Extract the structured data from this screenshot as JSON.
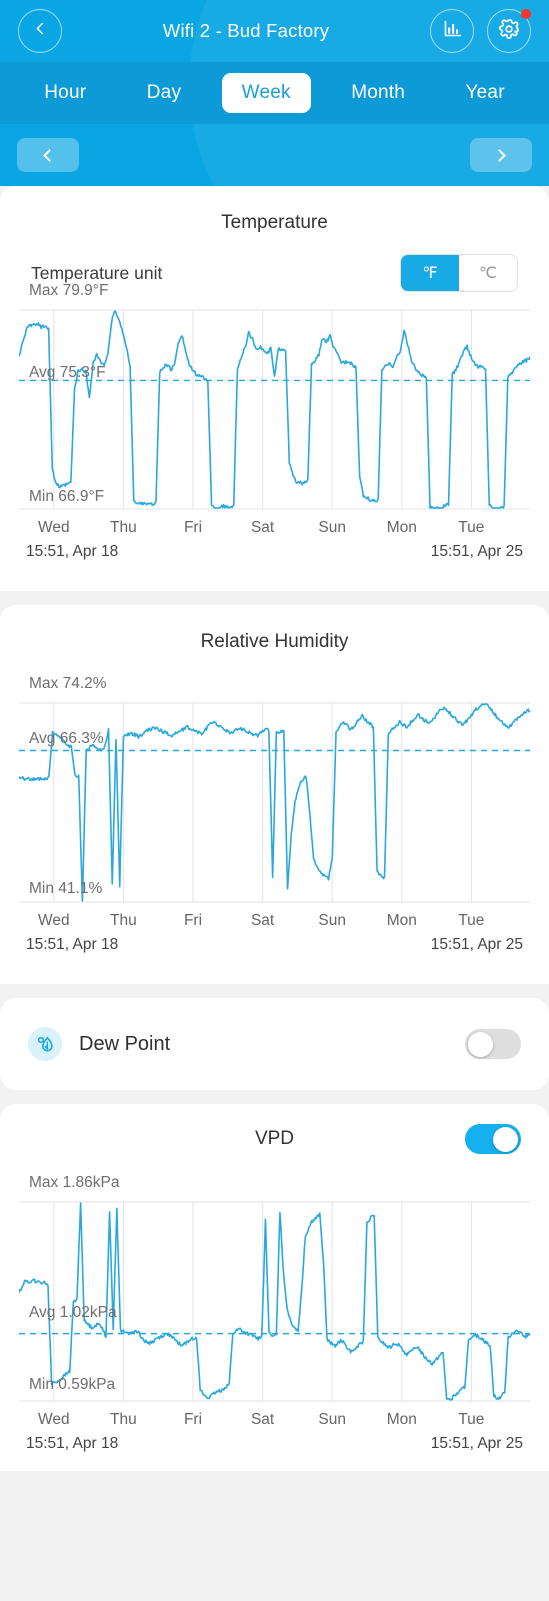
{
  "header": {
    "title": "Wifi 2 - Bud Factory",
    "back_icon": "chevron-left-icon",
    "stats_icon": "bar-chart-icon",
    "settings_icon": "gear-icon",
    "notification_dot_color": "#f5342b",
    "background_color": "#0aa6e3",
    "tabs": [
      {
        "label": "Hour",
        "active": false
      },
      {
        "label": "Day",
        "active": false
      },
      {
        "label": "Week",
        "active": true
      },
      {
        "label": "Month",
        "active": false
      },
      {
        "label": "Year",
        "active": false
      }
    ],
    "prev_label": "‹",
    "next_label": "›"
  },
  "temperature": {
    "title": "Temperature",
    "unit_label": "Temperature unit",
    "unit_options": [
      {
        "label": "℉",
        "selected": true
      },
      {
        "label": "℃",
        "selected": false
      }
    ],
    "max_label": "Max 79.9°F",
    "avg_label": "Avg 75.3°F",
    "min_label": "Min 66.9°F",
    "start_time": "15:51,  Apr 18",
    "end_time": "15:51,  Apr 25"
  },
  "humidity": {
    "title": "Relative Humidity",
    "max_label": "Max 74.2%",
    "avg_label": "Avg 66.3%",
    "min_label": "Min 41.1%",
    "start_time": "15:51,  Apr 18",
    "end_time": "15:51,  Apr 25"
  },
  "dew_point": {
    "title": "Dew Point",
    "icon": "dew-drop-icon",
    "enabled": false
  },
  "vpd": {
    "title": "VPD",
    "enabled": true,
    "max_label": "Max 1.86kPa",
    "avg_label": "Avg 1.02kPa",
    "min_label": "Min 0.59kPa",
    "start_time": "15:51,  Apr 18",
    "end_time": "15:51,  Apr 25"
  },
  "axis_days": [
    "Wed",
    "Thu",
    "Fri",
    "Sat",
    "Sun",
    "Mon",
    "Tue"
  ],
  "colors": {
    "line": "#29a8dd",
    "accent": "#0aa6e3",
    "grid": "#e3e3e3"
  },
  "chart_data": [
    {
      "type": "line",
      "title": "Temperature",
      "ylabel": "°F",
      "xlabel": "",
      "grid": true,
      "legend": "none",
      "ylim": [
        66.9,
        79.9
      ],
      "max": 79.9,
      "avg": 75.3,
      "min": 66.9,
      "avg_line": 75.3,
      "x_ticks": [
        "Wed",
        "Thu",
        "Fri",
        "Sat",
        "Sun",
        "Mon",
        "Tue"
      ],
      "x_range": [
        "15:51,  Apr 18",
        "15:51,  Apr 25"
      ],
      "values": [
        76.8,
        77.9,
        78.6,
        78.9,
        78.9,
        79.0,
        78.8,
        78.9,
        78.7,
        69.5,
        68.6,
        68.3,
        68.4,
        68.5,
        68.6,
        74.7,
        75.9,
        76.0,
        75.9,
        74.2,
        76.4,
        77.0,
        76.5,
        76.2,
        77.1,
        79.1,
        79.9,
        79.2,
        78.5,
        77.4,
        76.3,
        67.4,
        67.2,
        67.3,
        67.3,
        67.2,
        67.2,
        67.4,
        75.8,
        76.2,
        76.3,
        76.0,
        76.3,
        77.8,
        78.3,
        77.2,
        76.3,
        75.9,
        75.7,
        75.6,
        75.4,
        75.3,
        67.1,
        66.9,
        67.0,
        67.1,
        67.0,
        67.0,
        67.2,
        76.1,
        76.8,
        77.4,
        78.4,
        78.0,
        77.4,
        77.5,
        77.3,
        77.0,
        77.4,
        75.5,
        77.3,
        77.4,
        77.3,
        69.9,
        69.1,
        68.6,
        68.6,
        68.5,
        68.9,
        76.3,
        76.6,
        77.0,
        78.1,
        77.8,
        78.2,
        77.4,
        77.0,
        76.5,
        76.5,
        76.6,
        76.3,
        76.2,
        68.9,
        67.8,
        67.6,
        67.5,
        67.4,
        67.5,
        76.0,
        76.2,
        76.5,
        76.2,
        76.8,
        77.2,
        78.6,
        77.6,
        76.6,
        76.1,
        75.8,
        75.6,
        75.5,
        67.0,
        66.9,
        67.0,
        67.0,
        67.1,
        67.2,
        75.7,
        76.0,
        76.5,
        77.2,
        77.5,
        76.9,
        76.4,
        76.2,
        76.2,
        76.0,
        67.2,
        66.9,
        66.9,
        67.0,
        67.0,
        75.5,
        75.8,
        76.1,
        76.3,
        76.5,
        76.6,
        76.8
      ]
    },
    {
      "type": "line",
      "title": "Relative Humidity",
      "ylabel": "%",
      "xlabel": "",
      "grid": true,
      "legend": "none",
      "ylim": [
        41.1,
        74.2
      ],
      "max": 74.2,
      "avg": 66.3,
      "min": 41.1,
      "avg_line": 66.3,
      "x_ticks": [
        "Wed",
        "Thu",
        "Fri",
        "Sat",
        "Sun",
        "Mon",
        "Tue"
      ],
      "x_range": [
        "15:51,  Apr 18",
        "15:51,  Apr 25"
      ],
      "values": [
        62.0,
        61.8,
        61.5,
        61.6,
        61.5,
        61.5,
        61.6,
        61.5,
        61.7,
        69.2,
        69.0,
        68.5,
        68.0,
        67.3,
        66.8,
        62.2,
        62.0,
        41.1,
        66.1,
        66.8,
        67.0,
        66.6,
        66.4,
        67.0,
        69.8,
        44.2,
        68.3,
        43.9,
        68.8,
        69.0,
        69.2,
        69.0,
        68.6,
        68.8,
        69.5,
        69.8,
        70.1,
        70.0,
        69.6,
        69.3,
        69.0,
        68.8,
        69.2,
        69.5,
        69.8,
        70.2,
        70.0,
        69.6,
        69.4,
        69.1,
        69.8,
        70.5,
        71.2,
        70.8,
        70.2,
        69.8,
        69.4,
        69.2,
        69.6,
        70.1,
        69.8,
        69.5,
        69.2,
        69.0,
        68.8,
        69.3,
        70.0,
        69.6,
        45.3,
        69.2,
        69.5,
        69.3,
        43.2,
        52.4,
        57.6,
        60.2,
        61.5,
        62.0,
        55.5,
        48.1,
        46.7,
        45.8,
        45.4,
        45.0,
        48.6,
        69.2,
        70.3,
        71.0,
        70.4,
        69.9,
        70.5,
        71.3,
        72.0,
        71.4,
        70.8,
        70.2,
        46.0,
        45.5,
        45.2,
        68.9,
        69.8,
        70.4,
        71.0,
        70.6,
        70.2,
        70.9,
        71.6,
        72.2,
        71.8,
        71.2,
        70.8,
        71.5,
        72.3,
        73.0,
        73.4,
        72.8,
        72.2,
        71.6,
        71.0,
        70.5,
        71.2,
        72.0,
        72.8,
        73.4,
        74.0,
        74.2,
        73.6,
        72.8,
        72.0,
        71.4,
        70.8,
        70.2,
        70.6,
        71.2,
        71.8,
        72.4,
        72.8,
        73.0
      ]
    },
    {
      "type": "line",
      "title": "VPD",
      "ylabel": "kPa",
      "xlabel": "",
      "grid": true,
      "legend": "none",
      "ylim": [
        0.59,
        1.86
      ],
      "max": 1.86,
      "avg": 1.02,
      "min": 0.59,
      "avg_line": 1.02,
      "x_ticks": [
        "Wed",
        "Thu",
        "Fri",
        "Sat",
        "Sun",
        "Mon",
        "Tue"
      ],
      "x_range": [
        "15:51,  Apr 18",
        "15:51,  Apr 25"
      ],
      "values": [
        1.28,
        1.33,
        1.36,
        1.35,
        1.36,
        1.35,
        1.34,
        1.35,
        1.33,
        0.7,
        0.71,
        0.72,
        0.74,
        0.76,
        0.78,
        1.22,
        1.24,
        1.86,
        1.1,
        1.08,
        1.06,
        1.07,
        1.08,
        1.06,
        1.0,
        1.8,
        1.05,
        1.82,
        1.04,
        1.03,
        1.02,
        1.03,
        1.04,
        1.03,
        0.99,
        0.97,
        0.96,
        0.97,
        0.99,
        1.0,
        1.01,
        1.02,
        1.0,
        0.98,
        0.96,
        0.95,
        0.96,
        0.98,
        0.99,
        1.0,
        0.66,
        0.63,
        0.61,
        0.62,
        0.64,
        0.65,
        0.66,
        0.68,
        0.7,
        1.02,
        1.04,
        1.05,
        1.03,
        1.02,
        1.01,
        1.0,
        0.99,
        1.01,
        1.74,
        1.02,
        1.0,
        1.01,
        1.8,
        1.4,
        1.18,
        1.1,
        1.06,
        1.04,
        1.3,
        1.64,
        1.7,
        1.74,
        1.76,
        1.78,
        1.48,
        0.98,
        0.96,
        0.94,
        0.96,
        0.98,
        0.95,
        0.92,
        0.9,
        0.93,
        0.95,
        0.97,
        1.72,
        1.76,
        1.78,
        0.99,
        0.97,
        0.95,
        0.93,
        0.94,
        0.96,
        0.94,
        0.91,
        0.89,
        0.9,
        0.92,
        0.94,
        0.9,
        0.87,
        0.85,
        0.83,
        0.85,
        0.88,
        0.9,
        0.61,
        0.59,
        0.62,
        0.64,
        0.66,
        0.68,
        0.97,
        0.99,
        1.01,
        1.0,
        0.98,
        0.96,
        0.95,
        0.63,
        0.6,
        0.62,
        0.64,
        1.0,
        1.02,
        1.04,
        1.03,
        1.01,
        1.0,
        1.02
      ]
    }
  ]
}
